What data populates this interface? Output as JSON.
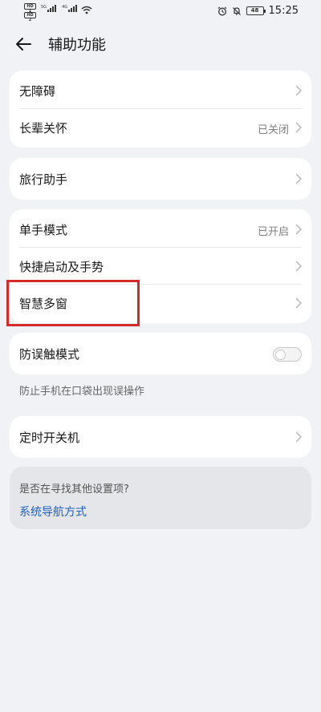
{
  "status_bar": {
    "hd_badge_1": "HD 1",
    "hd_badge_2": "HD 2",
    "signal_1_label": "5G",
    "signal_2_label": "4G",
    "battery": "48",
    "time": "15:25"
  },
  "header": {
    "title": "辅助功能"
  },
  "group1": [
    {
      "label": "无障碍",
      "value": ""
    },
    {
      "label": "长辈关怀",
      "value": "已关闭"
    }
  ],
  "group2": [
    {
      "label": "旅行助手",
      "value": ""
    }
  ],
  "group3": [
    {
      "label": "单手模式",
      "value": "已开启"
    },
    {
      "label": "快捷启动及手势",
      "value": ""
    },
    {
      "label": "智慧多窗",
      "value": ""
    }
  ],
  "anti_touch": {
    "label": "防误触模式",
    "enabled": false,
    "note": "防止手机在口袋出现误操作"
  },
  "group5": [
    {
      "label": "定时开关机",
      "value": ""
    }
  ],
  "help": {
    "question": "是否在寻找其他设置项?",
    "link": "系统导航方式"
  },
  "colors": {
    "background": "#f1f2f6",
    "card": "#ffffff",
    "link": "#1f5fbe",
    "highlight": "#d52b2b"
  }
}
